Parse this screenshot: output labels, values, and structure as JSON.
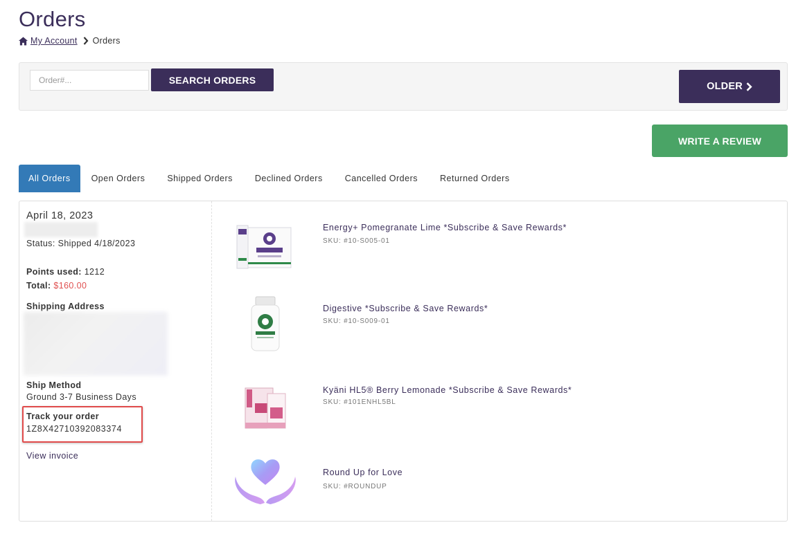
{
  "page": {
    "title": "Orders"
  },
  "breadcrumb": {
    "home_link": "My Account",
    "current": "Orders"
  },
  "search": {
    "placeholder": "Order#...",
    "button_label": "SEARCH ORDERS"
  },
  "older_button": {
    "label": "OLDER"
  },
  "review_button": {
    "label": "WRITE A REVIEW"
  },
  "tabs": [
    {
      "label": "All Orders",
      "active": true
    },
    {
      "label": "Open Orders"
    },
    {
      "label": "Shipped Orders"
    },
    {
      "label": "Declined Orders"
    },
    {
      "label": "Cancelled Orders"
    },
    {
      "label": "Returned Orders"
    }
  ],
  "order": {
    "date": "April 18, 2023",
    "status": "Status: Shipped 4/18/2023",
    "points_label": "Points used:",
    "points_value": "1212",
    "total_label": "Total:",
    "total_value": "$160.00",
    "shipping_address_label": "Shipping Address",
    "ship_method_label": "Ship Method",
    "ship_method_value": "Ground 3-7 Business Days",
    "track_label": "Track your order",
    "track_number": "1Z8X42710392083374",
    "view_invoice": "View invoice",
    "items": [
      {
        "name": "Energy+ Pomegranate Lime *Subscribe & Save Rewards*",
        "sku": "SKU: #10-S005-01"
      },
      {
        "name": "Digestive *Subscribe & Save Rewards*",
        "sku": "SKU: #10-S009-01"
      },
      {
        "name": "Kyäni HL5® Berry Lemonade *Subscribe & Save Rewards*",
        "sku": "SKU: #101ENHL5BL"
      },
      {
        "name": "Round Up for Love",
        "sku": "SKU: #ROUNDUP"
      }
    ]
  },
  "colors": {
    "brand_purple": "#3b2e5a",
    "tab_active": "#337ab7",
    "review_green": "#4aa466",
    "total_red": "#e05050",
    "highlight_red": "#e04a4a"
  },
  "icons": {
    "home": "home-icon",
    "breadcrumb_separator": "chevron-right-icon",
    "older": "chevron-right-icon"
  }
}
